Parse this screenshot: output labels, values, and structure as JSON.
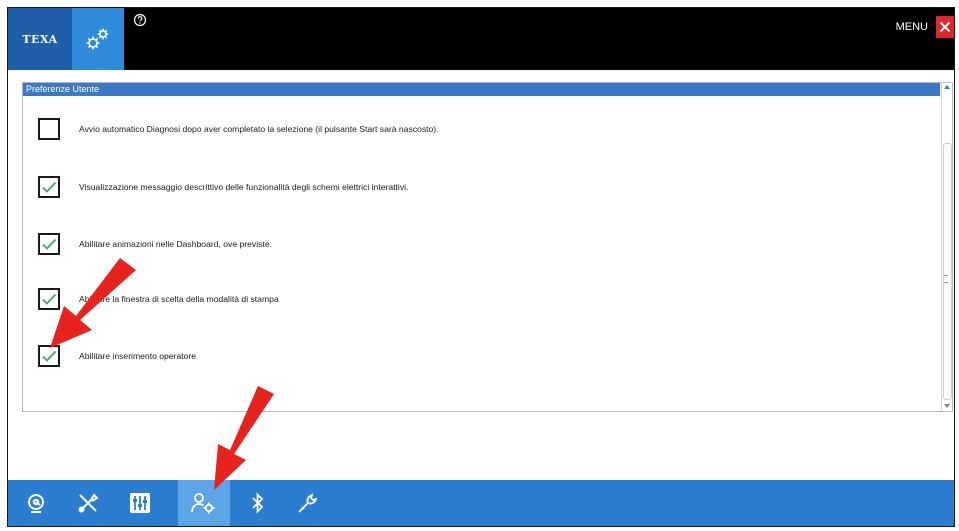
{
  "header": {
    "logo_text": "TEXA",
    "menu_label": "MENU",
    "accent_color": "#1f5fa9",
    "active_tile_color": "#2f8cdb",
    "close_color": "#e0262b"
  },
  "preferences": {
    "title": "Preferenze Utente",
    "options": [
      {
        "label": "Avvio automatico Diagnosi dopo aver completato la selezione (il pulsante Start sarà nascosto).",
        "checked": false
      },
      {
        "label": "Visualizzazione messaggio descrittivo delle funzionalità degli schemi elettrici interattivi.",
        "checked": true
      },
      {
        "label": "Abilitare animazioni nelle Dashboard, ove previste.",
        "checked": true
      },
      {
        "label": "Abilitare la finestra di scelta della modalità di stampa",
        "checked": true
      },
      {
        "label": "Abilitare inserimento operatore",
        "checked": true
      }
    ]
  },
  "bottom_nav": {
    "items": [
      {
        "icon": "diagnosis-icon",
        "active": false
      },
      {
        "icon": "tools-icon",
        "active": false
      },
      {
        "icon": "sliders-icon",
        "active": false
      },
      {
        "icon": "user-settings-icon",
        "active": true
      },
      {
        "icon": "bluetooth-icon",
        "active": false
      },
      {
        "icon": "wrench-icon",
        "active": false
      }
    ],
    "bar_color": "#2b7dd0",
    "active_color": "#5ba5e8"
  },
  "annotations": {
    "arrow_color": "#e8231d"
  }
}
